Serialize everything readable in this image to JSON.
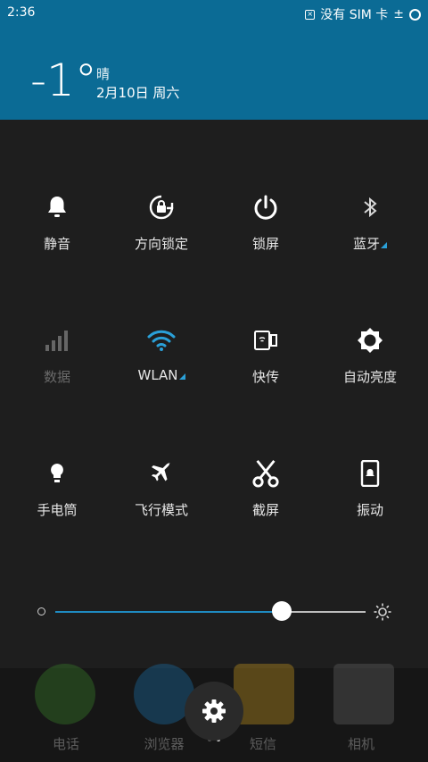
{
  "status_bar": {
    "time": "2:36",
    "sim_status": "没有 SIM 卡"
  },
  "weather": {
    "temperature": "-1°",
    "condition": "晴",
    "date": "2月10日 周六"
  },
  "toggles": [
    {
      "label": "静音",
      "icon": "bell-icon",
      "state": "on"
    },
    {
      "label": "方向锁定",
      "icon": "rotation-lock-icon",
      "state": "on"
    },
    {
      "label": "锁屏",
      "icon": "power-icon",
      "state": "on"
    },
    {
      "label": "蓝牙",
      "icon": "bluetooth-icon",
      "state": "on",
      "has_menu": true
    },
    {
      "label": "数据",
      "icon": "signal-bars-icon",
      "state": "off"
    },
    {
      "label": "WLAN",
      "icon": "wifi-icon",
      "state": "active",
      "has_menu": true
    },
    {
      "label": "快传",
      "icon": "transfer-icon",
      "state": "on"
    },
    {
      "label": "自动亮度",
      "icon": "auto-brightness-icon",
      "state": "on"
    },
    {
      "label": "手电筒",
      "icon": "flashlight-icon",
      "state": "on"
    },
    {
      "label": "飞行模式",
      "icon": "airplane-icon",
      "state": "on"
    },
    {
      "label": "截屏",
      "icon": "scissors-icon",
      "state": "on"
    },
    {
      "label": "振动",
      "icon": "vibrate-icon",
      "state": "on"
    }
  ],
  "brightness": {
    "level": 0.73
  },
  "dock": [
    {
      "label": "电话",
      "color": "#3b8b2a"
    },
    {
      "label": "浏览器",
      "color": "#1a78b6"
    },
    {
      "label": "短信",
      "color": "#d8a31f"
    },
    {
      "label": "相机",
      "color": "#6a6a6a"
    }
  ],
  "colors": {
    "header": "#0b6b95",
    "accent": "#2aa0d8",
    "panel": "#1e1e1e"
  }
}
